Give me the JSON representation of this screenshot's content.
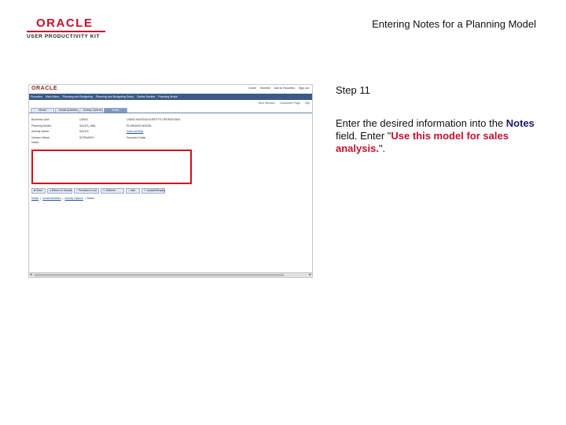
{
  "slide": {
    "logo_word": "ORACLE",
    "logo_tagline": "USER PRODUCTIVITY KIT",
    "title": "Entering Notes for a Planning Model"
  },
  "app": {
    "logo": "ORACLE",
    "top_links": [
      "Home",
      "Worklist",
      "Add to Favorites",
      "Sign out"
    ],
    "nav_items": [
      "Favorites",
      "Main Menu",
      "Planning and Budgeting",
      "Planning and Budgeting Setup",
      "Define Models",
      "Planning Model"
    ],
    "tools": [
      "New Window",
      "Customize Page",
      "http"
    ],
    "tabs": [
      "Model",
      "Model Activities",
      "Activity Options",
      "Notes"
    ],
    "active_tab": 3,
    "fields": [
      {
        "label": "Business Unit:",
        "value": "US002",
        "desc": "US002-MASSACHUSETTS OPERATIONS",
        "desc_link": false
      },
      {
        "label": "Planning Model:",
        "value": "SALES_MDL",
        "desc": "PLANNING MODEL",
        "desc_link": false
      },
      {
        "label": "Activity Name:",
        "value": "SALES",
        "desc": "Sales Activity",
        "desc_link": true
      },
      {
        "label": "Version Name:",
        "value": "SCENARIO",
        "desc": "Scenario Dollar",
        "desc_link": false
      }
    ],
    "notes_label": "Notes",
    "notes_value": "",
    "buttons": [
      {
        "icon": "save-icon",
        "label": "Save",
        "size": "sm"
      },
      {
        "icon": "return-icon",
        "label": "Return to Search",
        "size": "wide"
      },
      {
        "icon": "previous-icon",
        "label": "Previous in List",
        "size": "wide"
      },
      {
        "icon": "refresh-icon",
        "label": "Refresh",
        "size": "mid"
      },
      {
        "icon": "add-icon",
        "label": "Add",
        "size": "sm"
      },
      {
        "icon": "update-icon",
        "label": "Update/Display",
        "size": "mid"
      }
    ],
    "breadcrumbs": [
      "Model",
      "Model Activities",
      "Activity Options",
      "Notes"
    ]
  },
  "instructions": {
    "step": "Step 11",
    "text_before": "Enter the desired information into the ",
    "field_name": "Notes",
    "text_middle": " field. Enter \"",
    "entry_value": "Use this model for sales analysis.",
    "text_after": "\"."
  },
  "colors": {
    "brand_red": "#c8102e",
    "nav_blue": "#3b5a88",
    "highlight_red": "#d0111e",
    "field_name": "#1a1a66"
  }
}
